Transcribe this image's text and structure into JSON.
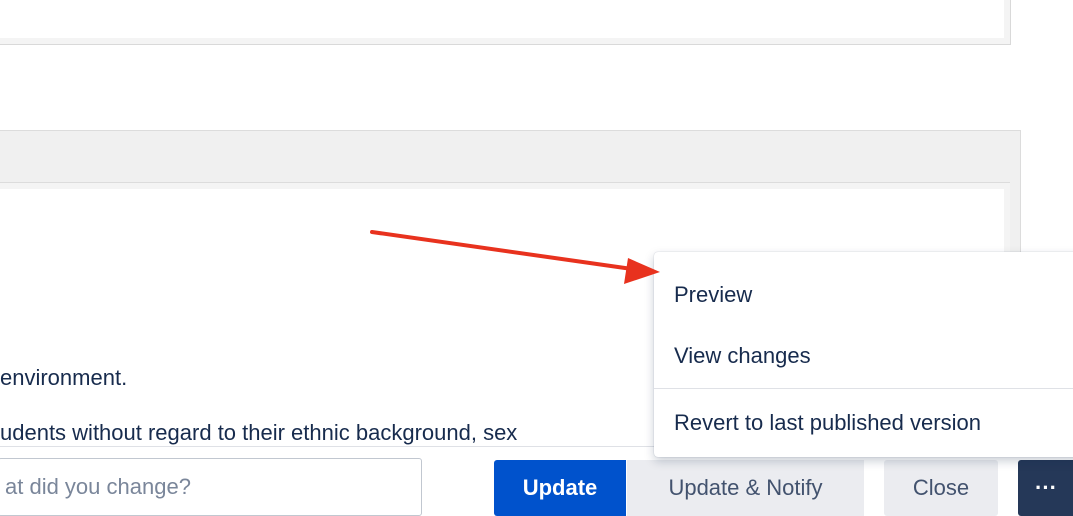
{
  "content": {
    "line1": "environment.",
    "line2": "udents without regard to their ethnic background, sex"
  },
  "footer": {
    "change_placeholder": "at did you change?",
    "update_label": "Update",
    "update_notify_label": "Update & Notify",
    "close_label": "Close",
    "more_label": "···"
  },
  "more_menu": {
    "items": [
      {
        "label": "Preview"
      },
      {
        "label": "View changes"
      },
      {
        "label": "Revert to last published version"
      }
    ]
  },
  "colors": {
    "primary": "#0052cc",
    "secondary_bg": "#ebecf0",
    "more_bg": "#253858",
    "annotation_arrow": "#e8321e"
  },
  "icons": [
    "more-icon",
    "annotation-arrow-icon"
  ]
}
